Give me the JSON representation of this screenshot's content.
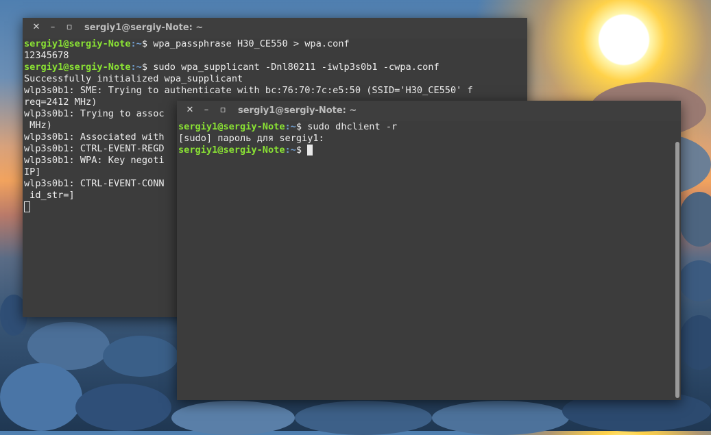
{
  "window_back": {
    "title": "sergiy1@sergiy-Note: ~",
    "controls": {
      "close": "✕",
      "minimize": "–",
      "maximize": "▫"
    },
    "lines": [
      {
        "user": "sergiy1@sergiy-Note",
        "path": ":~",
        "cmd": "$ wpa_passphrase H30_CE550 > wpa.conf"
      },
      {
        "text": "12345678"
      },
      {
        "user": "sergiy1@sergiy-Note",
        "path": ":~",
        "cmd": "$ sudo wpa_supplicant -Dnl80211 -iwlp3s0b1 -cwpa.conf"
      },
      {
        "text": "Successfully initialized wpa_supplicant"
      },
      {
        "text": "wlp3s0b1: SME: Trying to authenticate with bc:76:70:7c:e5:50 (SSID='H30_CE550' f"
      },
      {
        "text": "req=2412 MHz)"
      },
      {
        "text": "wlp3s0b1: Trying to assoc"
      },
      {
        "text": " MHz)"
      },
      {
        "text": "wlp3s0b1: Associated with"
      },
      {
        "text": "wlp3s0b1: CTRL-EVENT-REGD"
      },
      {
        "text": "wlp3s0b1: WPA: Key negoti"
      },
      {
        "text": "IP]"
      },
      {
        "text": "wlp3s0b1: CTRL-EVENT-CONN"
      },
      {
        "text": " id_str=]"
      }
    ]
  },
  "window_front": {
    "title": "sergiy1@sergiy-Note: ~",
    "controls": {
      "close": "✕",
      "minimize": "–",
      "maximize": "▫"
    },
    "lines": [
      {
        "user": "sergiy1@sergiy-Note",
        "path": ":~",
        "cmd": "$ sudo dhclient -r"
      },
      {
        "text": "[sudo] пароль для sergiy1:"
      },
      {
        "user": "sergiy1@sergiy-Note",
        "path": ":~",
        "cmd": "$ "
      }
    ]
  },
  "colors": {
    "prompt_user": "#8ae234",
    "prompt_path": "#729fcf",
    "terminal_bg": "#3c3c3c",
    "text": "#ededed"
  }
}
